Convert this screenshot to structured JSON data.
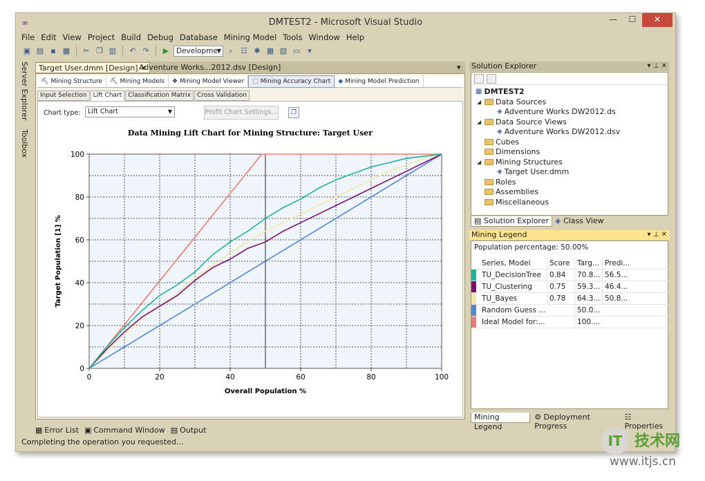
{
  "window": {
    "title": "DMTEST2 - Microsoft Visual Studio"
  },
  "menu": [
    "File",
    "Edit",
    "View",
    "Project",
    "Build",
    "Debug",
    "Database",
    "Mining Model",
    "Tools",
    "Window",
    "Help"
  ],
  "toolbar": {
    "config": "Developmer"
  },
  "left_strip": [
    "Server Explorer",
    "Toolbox"
  ],
  "doc_tabs": [
    "Target User.dmm [Design]",
    "Adventure Works...2012.dsv [Design]"
  ],
  "designer_tabs": [
    "Mining Structure",
    "Mining Models",
    "Mining Model Viewer",
    "Mining Accuracy Chart",
    "Mining Model Prediction"
  ],
  "accuracy_tabs": [
    "Input Selection",
    "Lift Chart",
    "Classification Matrix",
    "Cross Validation"
  ],
  "chart_controls": {
    "label": "Chart type:",
    "value": "Lift Chart",
    "profit_button": "Profit Chart Settings..."
  },
  "chart_data": {
    "type": "line",
    "title": "Data Mining Lift Chart for Mining Structure: Target User",
    "xlabel": "Overall Population %",
    "ylabel": "Target Population [1] %",
    "xlim": [
      0,
      100
    ],
    "ylim": [
      0,
      100
    ],
    "xticks": [
      0,
      20,
      40,
      60,
      80,
      100
    ],
    "yticks": [
      0,
      20,
      40,
      60,
      80,
      100
    ],
    "grid": true,
    "cursor_x": 50,
    "series": [
      {
        "name": "TU_DecisionTree",
        "color": "#1ab39a",
        "x": [
          0,
          5,
          10,
          15,
          20,
          25,
          30,
          35,
          40,
          45,
          50,
          55,
          60,
          65,
          70,
          75,
          80,
          85,
          90,
          95,
          100
        ],
        "y": [
          0,
          10,
          19,
          27,
          34,
          39,
          45,
          53,
          59,
          64,
          70,
          75,
          79,
          84,
          88,
          91,
          94,
          96,
          98,
          99,
          100
        ]
      },
      {
        "name": "TU_Clustering",
        "color": "#7a1070",
        "x": [
          0,
          5,
          10,
          15,
          20,
          25,
          30,
          35,
          40,
          45,
          50,
          55,
          60,
          65,
          70,
          75,
          80,
          85,
          90,
          95,
          100
        ],
        "y": [
          0,
          9,
          17,
          24,
          29,
          34,
          41,
          47,
          51,
          56,
          59,
          64,
          68,
          72,
          76,
          80,
          84,
          88,
          92,
          96,
          100
        ]
      },
      {
        "name": "TU_Bayes",
        "color": "#f0e9a8",
        "x": [
          0,
          5,
          10,
          15,
          20,
          25,
          30,
          35,
          40,
          45,
          50,
          55,
          60,
          65,
          70,
          75,
          80,
          85,
          90,
          95,
          100
        ],
        "y": [
          0,
          8,
          16,
          23,
          29,
          35,
          42,
          48,
          54,
          59,
          64,
          68,
          72,
          76,
          80,
          84,
          88,
          92,
          95,
          98,
          100
        ]
      },
      {
        "name": "Random Guess Model",
        "color": "#4f86d8",
        "x": [
          0,
          100
        ],
        "y": [
          0,
          100
        ]
      },
      {
        "name": "Ideal Model for: Target User",
        "color": "#ee7c76",
        "x": [
          0,
          49,
          100
        ],
        "y": [
          0,
          100,
          100
        ]
      }
    ]
  },
  "solution_explorer": {
    "title": "Solution Explorer",
    "root": "DMTEST2",
    "items": [
      {
        "label": "Data Sources",
        "level": 1,
        "folder": true,
        "exp": "◢"
      },
      {
        "label": "Adventure Works DW2012.ds",
        "level": 2,
        "folder": false,
        "exp": ""
      },
      {
        "label": "Data Source Views",
        "level": 1,
        "folder": true,
        "exp": "◢"
      },
      {
        "label": "Adventure Works DW2012.dsv",
        "level": 2,
        "folder": false,
        "exp": ""
      },
      {
        "label": "Cubes",
        "level": 1,
        "folder": true,
        "exp": ""
      },
      {
        "label": "Dimensions",
        "level": 1,
        "folder": true,
        "exp": ""
      },
      {
        "label": "Mining Structures",
        "level": 1,
        "folder": true,
        "exp": "◢"
      },
      {
        "label": "Target User.dmm",
        "level": 2,
        "folder": false,
        "exp": ""
      },
      {
        "label": "Roles",
        "level": 1,
        "folder": true,
        "exp": ""
      },
      {
        "label": "Assemblies",
        "level": 1,
        "folder": true,
        "exp": ""
      },
      {
        "label": "Miscellaneous",
        "level": 1,
        "folder": true,
        "exp": ""
      }
    ],
    "tabs": [
      "Solution Explorer",
      "Class View"
    ]
  },
  "mining_legend": {
    "title": "Mining Legend",
    "population": "Population percentage: 50.00%",
    "headers": [
      "Series, Model",
      "Score",
      "Targ...",
      "Predi..."
    ],
    "rows": [
      {
        "name": "TU_DecisionTree",
        "score": "0.84",
        "target": "70.8...",
        "predict": "56.5...",
        "color": "#1ab39a"
      },
      {
        "name": "TU_Clustering",
        "score": "0.75",
        "target": "59.3...",
        "predict": "46.4...",
        "color": "#7a1070"
      },
      {
        "name": "TU_Bayes",
        "score": "0.78",
        "target": "64.3...",
        "predict": "50.8...",
        "color": "#f0e9a8"
      },
      {
        "name": "Random Guess ...",
        "score": "",
        "target": "50.0...",
        "predict": "",
        "color": "#4f86d8"
      },
      {
        "name": "Ideal Model for:...",
        "score": "",
        "target": "100....",
        "predict": "",
        "color": "#ee7c76"
      }
    ],
    "tabs": [
      "Mining Legend",
      "Deployment Progress",
      "Properties"
    ]
  },
  "bottom_tabs": [
    "Error List",
    "Command Window",
    "Output"
  ],
  "status": "Completing the operation you requested...",
  "watermark": {
    "logo": "IT",
    "cn": "技术网",
    "url": "www.itjs.cn"
  }
}
